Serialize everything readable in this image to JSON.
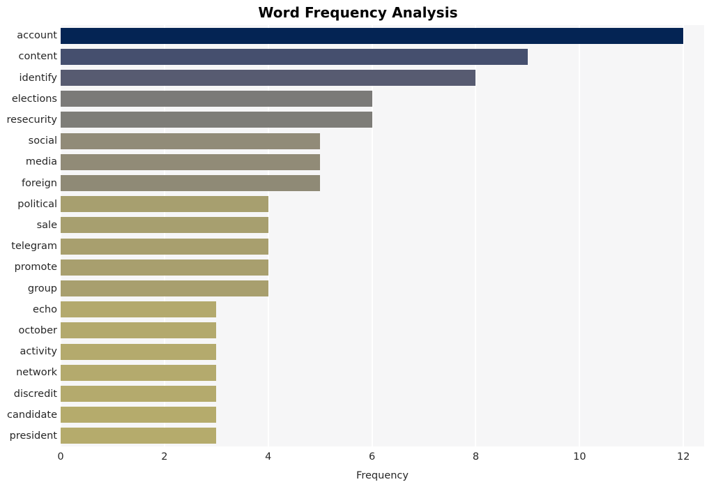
{
  "chart_data": {
    "type": "bar",
    "orientation": "horizontal",
    "title": "Word Frequency Analysis",
    "xlabel": "Frequency",
    "ylabel": "",
    "xlim": [
      0,
      12.4
    ],
    "xticks": [
      0,
      2,
      4,
      6,
      8,
      10,
      12
    ],
    "xtick_labels": [
      "0",
      "2",
      "4",
      "6",
      "8",
      "10",
      "12"
    ],
    "grid": true,
    "grid_axis": "x",
    "legend": null,
    "categories": [
      "account",
      "content",
      "identify",
      "elections",
      "resecurity",
      "social",
      "media",
      "foreign",
      "political",
      "sale",
      "telegram",
      "promote",
      "group",
      "echo",
      "october",
      "activity",
      "network",
      "discredit",
      "candidate",
      "president"
    ],
    "values": [
      12,
      9,
      8,
      6,
      6,
      5,
      5,
      5,
      4,
      4,
      4,
      4,
      4,
      3,
      3,
      3,
      3,
      3,
      3,
      3
    ],
    "bar_colors": [
      "#042454",
      "#454f6e",
      "#575b71",
      "#7b7a78",
      "#7e7d78",
      "#918b78",
      "#918b77",
      "#8f8a76",
      "#a79f6f",
      "#a79f6f",
      "#a89f6e",
      "#a89f6e",
      "#a89f6e",
      "#b3a96d",
      "#b3a96d",
      "#b4aa6d",
      "#b4aa6d",
      "#b4aa6d",
      "#b5ab6c",
      "#b5ab6c"
    ],
    "plot_background": "#f6f6f7",
    "grid_color": "#ffffff",
    "figure_background": "#ffffff",
    "text_color": "#262626"
  }
}
